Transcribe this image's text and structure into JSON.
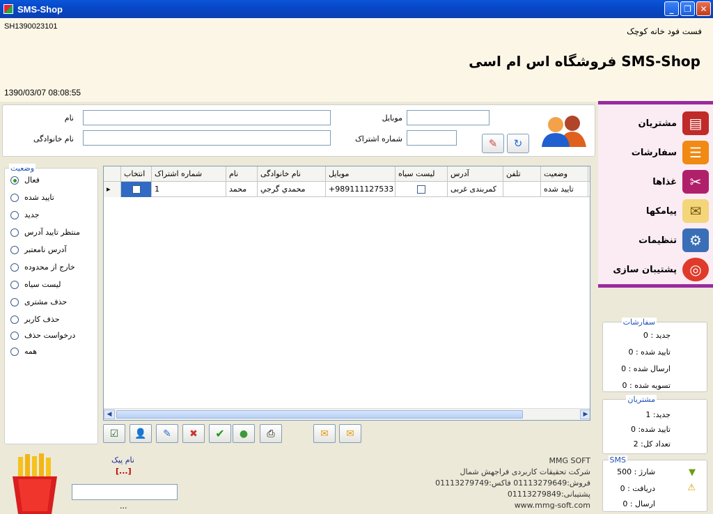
{
  "window": {
    "title": "SMS-Shop",
    "buttons": {
      "minimize": "_",
      "maximize": "❐",
      "close": "✕"
    }
  },
  "header": {
    "shop_code": "SH1390023101",
    "subtitle": "فست فود خانه کوچک",
    "shop_name": "SMS-Shop فروشگاه اس ام اسی",
    "datetime": "1390/03/07 08:08:55"
  },
  "search": {
    "name_label": "نام",
    "family_label": "نام خانوادگی",
    "mobile_label": "موبایل",
    "subscription_label": "شماره اشتراک"
  },
  "status": {
    "title": "وضعیت",
    "options": [
      "فعال",
      "تایید شده",
      "جدید",
      "منتظر تایید آدرس",
      "آدرس نامعتبر",
      "خارج از محدوده",
      "لیست سیاه",
      "حذف مشتری",
      "حذف کاربر",
      "درخواست حذف",
      "همه"
    ],
    "selected": "فعال"
  },
  "grid": {
    "columns": {
      "status": "وضعیت",
      "phone": "تلفن",
      "address": "آدرس",
      "blacklist": "لیست سیاه",
      "mobile": "موبایل",
      "family": "نام خانوادگی",
      "name": "نام",
      "subscription": "شماره اشتراک",
      "select": "انتخاب"
    },
    "rows": [
      {
        "status": "تایید شده",
        "phone": "",
        "address": "کمربندی غربی",
        "blacklist": false,
        "mobile": "+989111127533",
        "family": "محمدي گرجي",
        "name": "محمد",
        "subscription": "1",
        "selected": false
      }
    ]
  },
  "nav": {
    "items": [
      "مشتریان",
      "سفارشات",
      "غذاها",
      "پیامکها",
      "تنظیمات",
      "پشتیبان سازی"
    ]
  },
  "orders_stats": {
    "title": "سفارشات",
    "new": "جدید : 0",
    "confirmed": "تایید شده : 0",
    "sent": "ارسال شده : 0",
    "settled": "تسویه شده : 0"
  },
  "customers_stats": {
    "title": "مشتریان",
    "new": "جدید: 1",
    "confirmed": "تایید شده: 0",
    "total": "تعداد کل: 2"
  },
  "sms_stats": {
    "title": "SMS",
    "charge": "شارژ : 500",
    "received": "دریافت : 0",
    "sent": "ارسال : 0"
  },
  "footer": {
    "company": "MMG SOFT",
    "company_full": "شرکت تحقیقات کاربردی فراجهش شمال",
    "sales": "فروش:01113279649 فاکس:01113279749",
    "support": "پشتیبانی:01113279849",
    "website": "www.mmg-soft.com",
    "courier_label": "نام پیک",
    "courier_value": "[...]",
    "dots": "..."
  }
}
